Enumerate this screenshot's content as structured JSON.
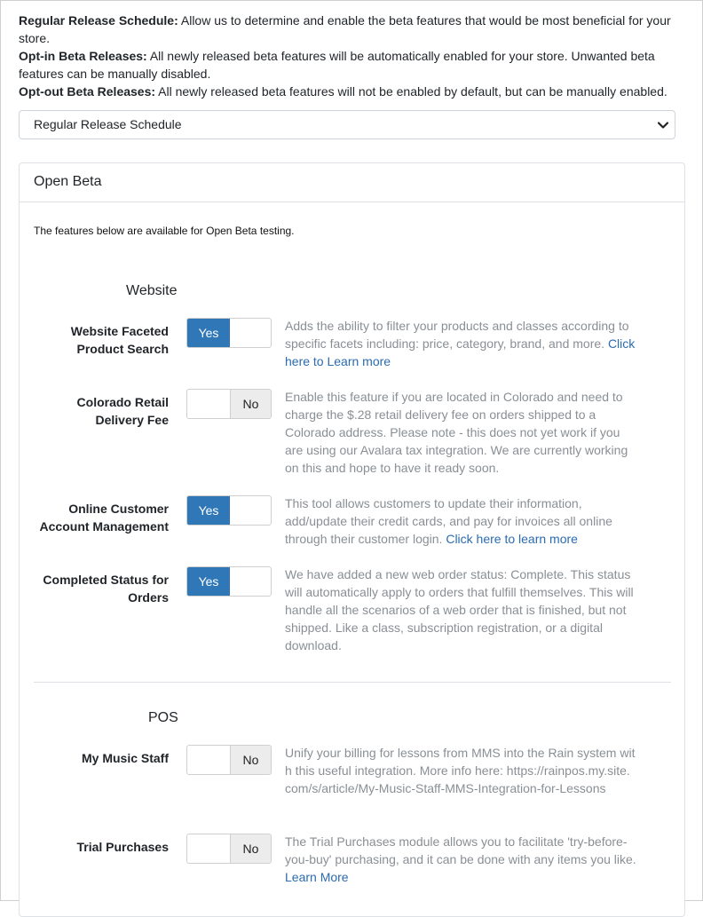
{
  "intro": {
    "lines": [
      {
        "title": "Regular Release Schedule:",
        "text": " Allow us to determine and enable the beta features that would be most beneficial for your store."
      },
      {
        "title": "Opt-in Beta Releases:",
        "text": " All newly released beta features will be automatically enabled for your store. Unwanted beta features can be manually disabled."
      },
      {
        "title": "Opt-out Beta Releases:",
        "text": " All newly released beta features will not be enabled by default, but can be manually enabled."
      }
    ]
  },
  "release_select": {
    "value": "Regular Release Schedule"
  },
  "card": {
    "title": "Open Beta",
    "description": "The features below are available for Open Beta testing."
  },
  "sections": [
    {
      "title": "Website",
      "features": [
        {
          "label": "Website Faceted Product Search",
          "state": "Yes",
          "desc": "Adds the ability to filter your products and classes according to specific facets including: price, category, brand, and more. ",
          "link": "Click here to Learn more"
        },
        {
          "label": "Colorado Retail Delivery Fee",
          "state": "No",
          "desc": "Enable this feature if you are located in Colorado and need to charge the $.28 retail delivery fee on orders shipped to a Colorado address. Please note - this does not yet work if you are using our Avalara tax integration. We are currently working on this and hope to have it ready soon.",
          "link": ""
        },
        {
          "label": "Online Customer Account Management",
          "state": "Yes",
          "desc": "This tool allows customers to update their information, add/update their credit cards, and pay for invoices all online through their customer login. ",
          "link": "Click here to learn more"
        },
        {
          "label": "Completed Status for Orders",
          "state": "Yes",
          "desc": "We have added a new web order status: Complete. This status will automatically apply to orders that fulfill themselves. This will handle all the scenarios of a web order that is finished, but not shipped. Like a class, subscription registration, or a digital download.",
          "link": ""
        }
      ]
    },
    {
      "title": "POS",
      "features": [
        {
          "label": "My Music Staff",
          "state": "No",
          "desc": "Unify your billing for lessons from MMS into the Rain system with this useful integration. More info here: https://rainpos.my.site.com/s/article/My-Music-Staff-MMS-Integration-for-Lessons",
          "link": ""
        },
        {
          "label": "Trial Purchases",
          "state": "No",
          "desc": "The Trial Purchases module allows you to facilitate 'try-before-you-buy' purchasing, and it can be done with any items you like. ",
          "link": "Learn More"
        }
      ]
    }
  ],
  "toggle_labels": {
    "yes": "Yes",
    "no": "No"
  },
  "colors": {
    "accent": "#2f77b7",
    "link": "#2a6bb1",
    "muted_text": "#8a8f94"
  }
}
